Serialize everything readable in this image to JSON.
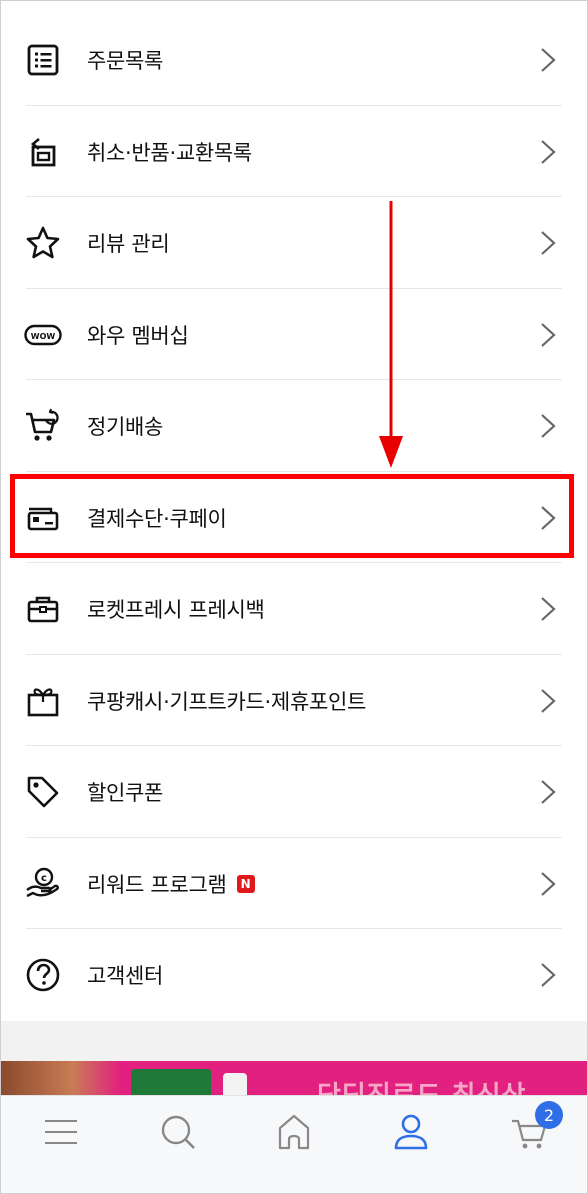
{
  "menu": {
    "items": [
      {
        "icon": "order-list-icon",
        "label": "주문목록"
      },
      {
        "icon": "return-icon",
        "label": "취소·반품·교환목록"
      },
      {
        "icon": "star-icon",
        "label": "리뷰 관리"
      },
      {
        "icon": "wow-icon",
        "label": "와우 멤버십"
      },
      {
        "icon": "subscription-cart-icon",
        "label": "정기배송"
      },
      {
        "icon": "payment-card-icon",
        "label": "결제수단·쿠페이"
      },
      {
        "icon": "fresh-bag-icon",
        "label": "로켓프레시 프레시백"
      },
      {
        "icon": "gift-icon",
        "label": "쿠팡캐시·기프트카드·제휴포인트"
      },
      {
        "icon": "coupon-tag-icon",
        "label": "할인쿠폰"
      },
      {
        "icon": "reward-coin-icon",
        "label": "리워드 프로그램",
        "badge": "N"
      },
      {
        "icon": "help-icon",
        "label": "고객센터"
      }
    ]
  },
  "wow_icon_text": "WOW",
  "banner": {
    "text": "단딘진로드 최신상"
  },
  "tabbar": {
    "tabs": [
      "menu-icon",
      "search-icon",
      "home-icon",
      "my-page-icon",
      "cart-icon"
    ],
    "cart_count": "2"
  },
  "colors": {
    "highlight": "#ff0000",
    "accent": "#2f6ee6",
    "badge": "#e01a1a"
  }
}
